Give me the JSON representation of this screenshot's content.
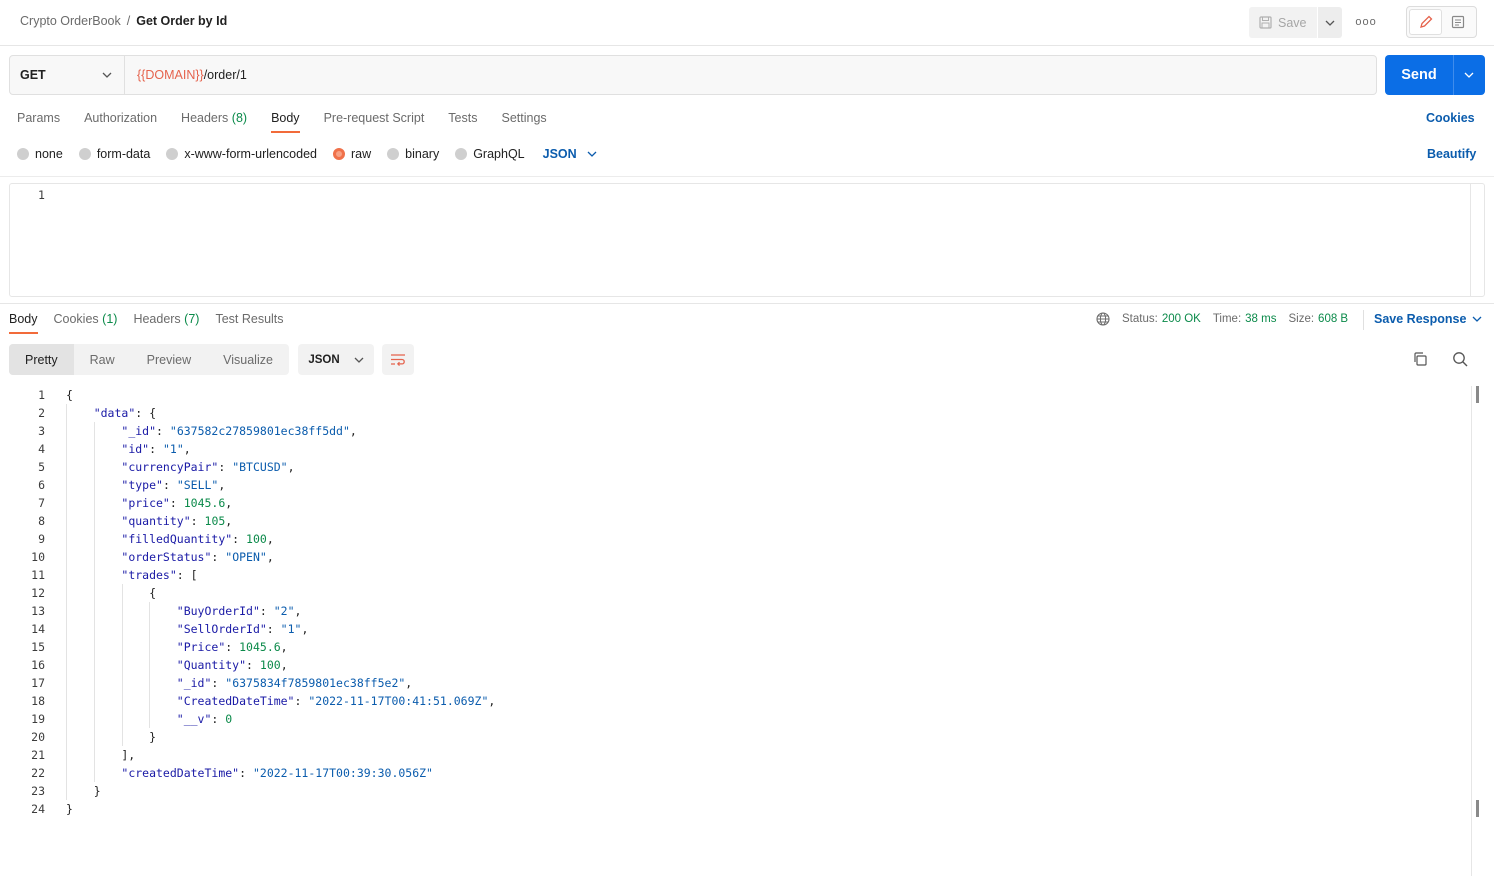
{
  "breadcrumb": {
    "collection": "Crypto OrderBook",
    "separator": "/",
    "request": "Get Order by Id"
  },
  "toolbar": {
    "save_label": "Save",
    "more_label": "ooo"
  },
  "request": {
    "method": "GET",
    "url_var": "{{DOMAIN}}",
    "url_path": "/order/1",
    "send_label": "Send"
  },
  "req_tabs": {
    "params": "Params",
    "authorization": "Authorization",
    "headers": "Headers",
    "headers_count": "(8)",
    "body": "Body",
    "prerequest": "Pre-request Script",
    "tests": "Tests",
    "settings": "Settings",
    "cookies": "Cookies"
  },
  "body_types": {
    "none": "none",
    "form_data": "form-data",
    "urlencoded": "x-www-form-urlencoded",
    "raw": "raw",
    "binary": "binary",
    "graphql": "GraphQL",
    "language": "JSON",
    "beautify": "Beautify"
  },
  "req_editor": {
    "line": "1"
  },
  "resp_tabs": {
    "body": "Body",
    "cookies": "Cookies",
    "cookies_count": "(1)",
    "headers": "Headers",
    "headers_count": "(7)",
    "test_results": "Test Results"
  },
  "status": {
    "status_label": "Status:",
    "status_value": "200 OK",
    "time_label": "Time:",
    "time_value": "38 ms",
    "size_label": "Size:",
    "size_value": "608 B",
    "save_response": "Save Response"
  },
  "view": {
    "pretty": "Pretty",
    "raw": "Raw",
    "preview": "Preview",
    "visualize": "Visualize",
    "format": "JSON"
  },
  "response_lines": [
    {
      "n": "1",
      "t": "{"
    },
    {
      "n": "2",
      "t": "    \"data\": {"
    },
    {
      "n": "3",
      "t": "        \"_id\": \"637582c27859801ec38ff5dd\","
    },
    {
      "n": "4",
      "t": "        \"id\": \"1\","
    },
    {
      "n": "5",
      "t": "        \"currencyPair\": \"BTCUSD\","
    },
    {
      "n": "6",
      "t": "        \"type\": \"SELL\","
    },
    {
      "n": "7",
      "t": "        \"price\": 1045.6,"
    },
    {
      "n": "8",
      "t": "        \"quantity\": 105,"
    },
    {
      "n": "9",
      "t": "        \"filledQuantity\": 100,"
    },
    {
      "n": "10",
      "t": "        \"orderStatus\": \"OPEN\","
    },
    {
      "n": "11",
      "t": "        \"trades\": ["
    },
    {
      "n": "12",
      "t": "            {"
    },
    {
      "n": "13",
      "t": "                \"BuyOrderId\": \"2\","
    },
    {
      "n": "14",
      "t": "                \"SellOrderId\": \"1\","
    },
    {
      "n": "15",
      "t": "                \"Price\": 1045.6,"
    },
    {
      "n": "16",
      "t": "                \"Quantity\": 100,"
    },
    {
      "n": "17",
      "t": "                \"_id\": \"6375834f7859801ec38ff5e2\","
    },
    {
      "n": "18",
      "t": "                \"CreatedDateTime\": \"2022-11-17T00:41:51.069Z\","
    },
    {
      "n": "19",
      "t": "                \"__v\": 0"
    },
    {
      "n": "20",
      "t": "            }"
    },
    {
      "n": "21",
      "t": "        ],"
    },
    {
      "n": "22",
      "t": "        \"createdDateTime\": \"2022-11-17T00:39:30.056Z\""
    },
    {
      "n": "23",
      "t": "    }"
    },
    {
      "n": "24",
      "t": "}"
    }
  ],
  "colors": {
    "accent": "#0b6ee6",
    "tab_underline": "#f26b3a",
    "json_key": "#1a1aa6",
    "json_string": "#0b5cad",
    "json_number": "#0b8a4a",
    "url_variable": "#e5634d"
  }
}
